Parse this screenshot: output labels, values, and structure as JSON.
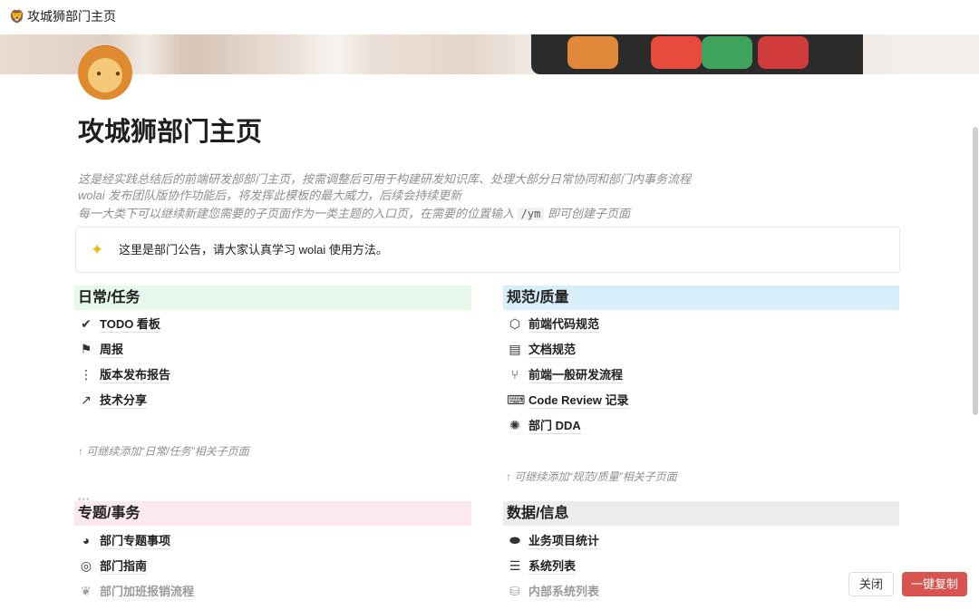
{
  "window": {
    "title": "攻城狮部门主页"
  },
  "page": {
    "title": "攻城狮部门主页",
    "desc_line1": "这是经实践总结后的前端研发部部门主页，按需调整后可用于构建研发知识库、处理大部分日常协同和部门内事务流程",
    "desc_line2": "wolai 发布团队版协作功能后，将发挥此模板的最大威力，后续会持续更新",
    "desc_line3_before": "每一大类下可以继续新建您需要的子页面作为一类主题的入口页，在需要的位置输入",
    "desc_line3_code": "/ym",
    "desc_line3_after": "即可创建子页面"
  },
  "callout": {
    "icon": "sparkle-icon",
    "text": "这里是部门公告，请大家认真学习 wolai 使用方法。"
  },
  "sections": {
    "daily": {
      "title": "日常/任务",
      "color": "#e6f7ec",
      "items": [
        {
          "label": "TODO 看板",
          "icon": "check-circle-icon"
        },
        {
          "label": "周报",
          "icon": "flag-icon"
        },
        {
          "label": "版本发布报告",
          "icon": "traffic-light-icon"
        },
        {
          "label": "技术分享",
          "icon": "share-icon"
        }
      ],
      "hint": "↑ 可继续添加“日常/任务”相关子页面"
    },
    "spec": {
      "title": "规范/质量",
      "color": "#d9eefb",
      "items": [
        {
          "label": "前端代码规范",
          "icon": "html5-icon"
        },
        {
          "label": "文档规范",
          "icon": "document-icon"
        },
        {
          "label": "前端一般研发流程",
          "icon": "git-branch-icon"
        },
        {
          "label": "Code Review 记录",
          "icon": "laptop-code-icon"
        },
        {
          "label": "部门 DDA",
          "icon": "spider-icon"
        }
      ],
      "hint": "↑ 可继续添加“规范/质量”相关子页面"
    },
    "topics": {
      "title": "专题/事务",
      "color": "#fbe9ef",
      "items": [
        {
          "label": "部门专题事项",
          "icon": "palette-icon"
        },
        {
          "label": "部门指南",
          "icon": "compass-icon"
        },
        {
          "label": "部门加班报销流程",
          "icon": "leaf-icon"
        }
      ]
    },
    "data": {
      "title": "数据/信息",
      "color": "#ececec",
      "items": [
        {
          "label": "业务项目统计",
          "icon": "pill-icon"
        },
        {
          "label": "系统列表",
          "icon": "server-icon"
        },
        {
          "label": "内部系统列表",
          "icon": "database-icon"
        }
      ]
    }
  },
  "footer": {
    "close_label": "关闭",
    "copy_label": "一键复制",
    "accent": "#d9534f"
  }
}
